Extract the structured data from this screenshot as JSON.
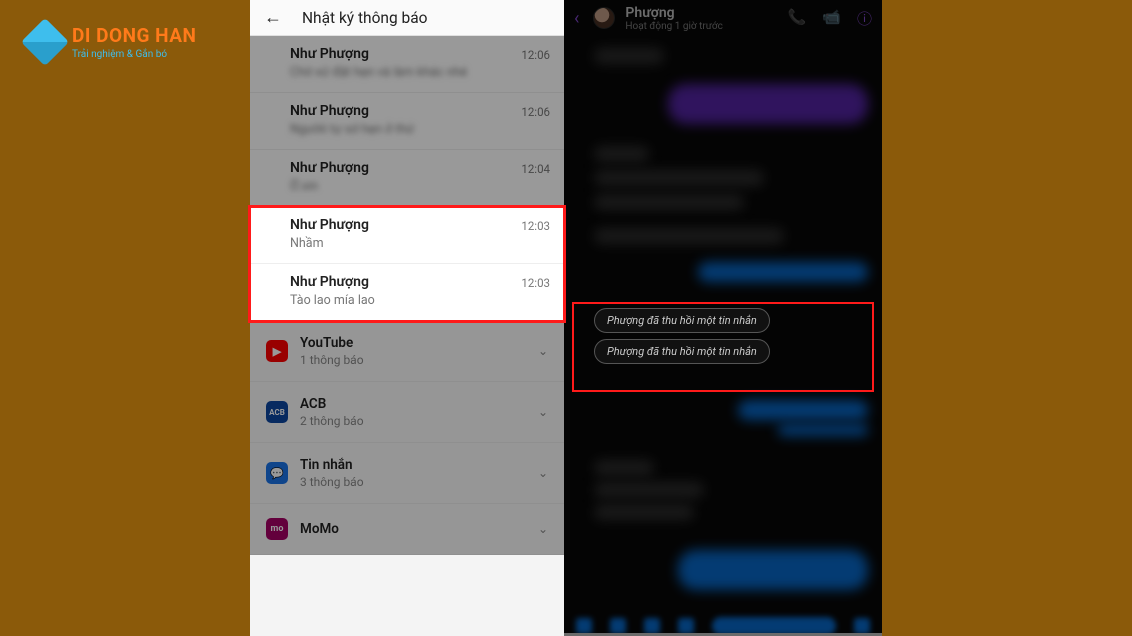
{
  "logo": {
    "main": "DI DONG HAN",
    "sub": "Trải nghiệm & Gắn bó"
  },
  "left": {
    "title": "Nhật ký thông báo",
    "dim_notifs": [
      {
        "name": "Như Phượng",
        "msg": "Chờ xử đặt hẹn và làm khác nhé",
        "time": "12:06"
      },
      {
        "name": "Như Phượng",
        "msg": "Ngườii tự sớ hẹn ở thứ",
        "time": "12:06"
      },
      {
        "name": "Như Phượng",
        "msg": "Ờ.xin",
        "time": "12:04"
      }
    ],
    "hl_notifs": [
      {
        "name": "Như Phượng",
        "msg": "Nhầm",
        "time": "12:03"
      },
      {
        "name": "Như Phượng",
        "msg": "Tào lao mía lao",
        "time": "12:03"
      }
    ],
    "apps": [
      {
        "title": "YouTube",
        "sub": "1 thông báo",
        "icon": "yt"
      },
      {
        "title": "ACB",
        "sub": "2 thông báo",
        "icon": "acb"
      },
      {
        "title": "Tin nhắn",
        "sub": "3 thông báo",
        "icon": "msg"
      },
      {
        "title": "MoMo",
        "sub": "",
        "icon": "momo"
      }
    ]
  },
  "right": {
    "name": "Phượng",
    "status": "Hoạt động 1 giờ trước",
    "recalled": [
      "Phượng đã thu hồi một tin nhắn",
      "Phượng đã thu hồi một tin nhắn"
    ]
  }
}
